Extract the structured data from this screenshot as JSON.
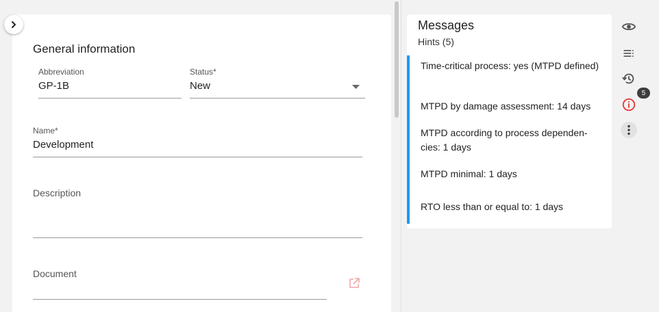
{
  "form": {
    "section_title": "General information",
    "abbreviation": {
      "label": "Abbreviation",
      "value": "GP-1B"
    },
    "status": {
      "label": "Status*",
      "value": "New"
    },
    "name": {
      "label": "Name*",
      "value": "Development"
    },
    "description": {
      "label": "Description",
      "value": ""
    },
    "document": {
      "label": "Document",
      "value": ""
    }
  },
  "messages": {
    "title": "Messages",
    "hints_label": "Hints (5)",
    "hints": [
      "Time-critical process: yes (MTPD defined)",
      "MTPD by damage assessment: 14 days",
      "MTPD according to process dependen-cies: 1 days",
      "MTPD minimal: 1 days",
      "RTO less than or equal to: 1 days"
    ]
  },
  "sidebar": {
    "icons": [
      "eye-icon",
      "list-icon",
      "history-icon",
      "info-icon",
      "more-vert-icon"
    ],
    "badge_count": "5"
  },
  "colors": {
    "accent": "#2196f3",
    "info_red": "#e53935",
    "link_icon": "#f4a6a6"
  }
}
